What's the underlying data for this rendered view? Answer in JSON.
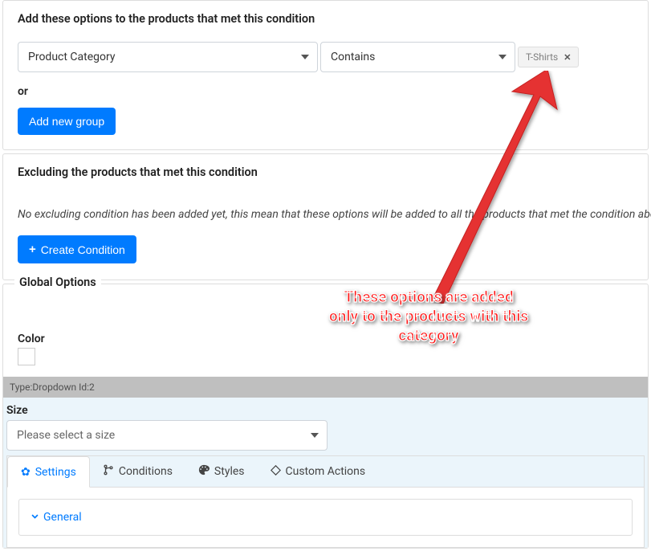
{
  "add_section": {
    "header": "Add these options to the products that met this condition",
    "field_select": "Product Category",
    "operator_select": "Contains",
    "tag_label": "T-Shirts",
    "or_label": "or",
    "add_group_button": "Add new group"
  },
  "exclude_section": {
    "header": "Excluding the products that met this condition",
    "note": "No excluding condition has been added yet, this mean that these options will be added to all the products that met the condition above witho",
    "create_button": "Create Condition"
  },
  "global_options": {
    "legend": "Global Options",
    "color_label": "Color",
    "type_row": "Type:Dropdown Id:2",
    "size_label": "Size",
    "size_placeholder": "Please select a size",
    "tabs": {
      "settings": "Settings",
      "conditions": "Conditions",
      "styles": "Styles",
      "custom_actions": "Custom Actions"
    },
    "general_row": "General"
  },
  "annotation": {
    "line1": "These options are added",
    "line2": "only to the products with this",
    "line3": "category"
  }
}
